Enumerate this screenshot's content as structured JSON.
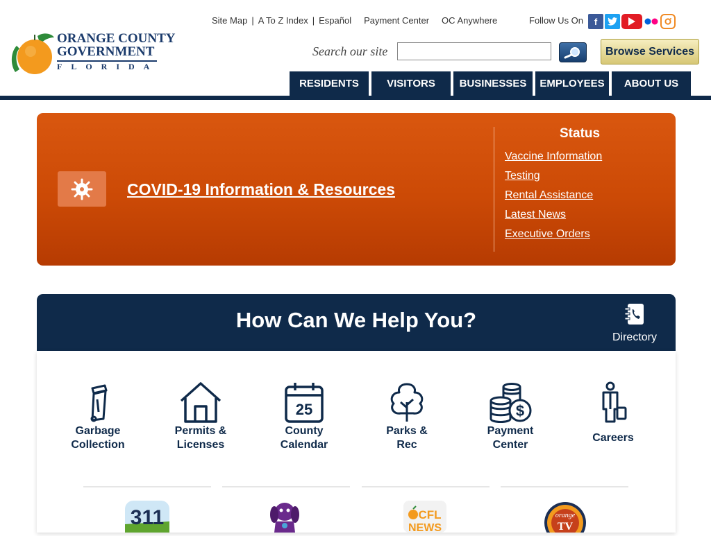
{
  "header": {
    "logo": {
      "line1": "ORANGE COUNTY",
      "line2": "GOVERNMENT",
      "line3": "FLORIDA"
    },
    "top_links": [
      "Site Map",
      "A To Z Index",
      "Español",
      "Payment Center",
      "OC Anywhere"
    ],
    "follow_label": "Follow Us On",
    "social_icons": [
      "facebook-icon",
      "twitter-icon",
      "youtube-icon",
      "flickr-icon",
      "instagram-icon"
    ],
    "search": {
      "label": "Search our site",
      "value": "",
      "placeholder": ""
    },
    "browse_label": "Browse Services",
    "nav": [
      "RESIDENTS",
      "VISITORS",
      "BUSINESSES",
      "EMPLOYEES",
      "ABOUT US"
    ]
  },
  "covid": {
    "link_label": "COVID-19 Information & Resources",
    "status_title": "Status",
    "status_links": [
      "Vaccine Information",
      "Testing",
      "Rental Assistance",
      "Latest News",
      "Executive Orders"
    ]
  },
  "help": {
    "title": "How Can We Help You?",
    "directory_label": "Directory",
    "services": [
      {
        "line1": "Garbage",
        "line2": "Collection",
        "icon": "garbage-can-icon"
      },
      {
        "line1": "Permits &",
        "line2": "Licenses",
        "icon": "house-icon"
      },
      {
        "line1": "County",
        "line2": "Calendar",
        "icon": "calendar-icon",
        "day": "25"
      },
      {
        "line1": "Parks &",
        "line2": "Rec",
        "icon": "tree-icon"
      },
      {
        "line1": "Payment",
        "line2": "Center",
        "icon": "coins-icon"
      },
      {
        "line1": "Careers",
        "line2": "",
        "icon": "person-briefcase-icon"
      }
    ],
    "bottom_logos": {
      "logo_311": "311",
      "news": "CFL NEWS"
    }
  },
  "colors": {
    "navy": "#0f2a4a",
    "covid_orange": "#cc4a06",
    "browse_gold": "#d7c776"
  }
}
